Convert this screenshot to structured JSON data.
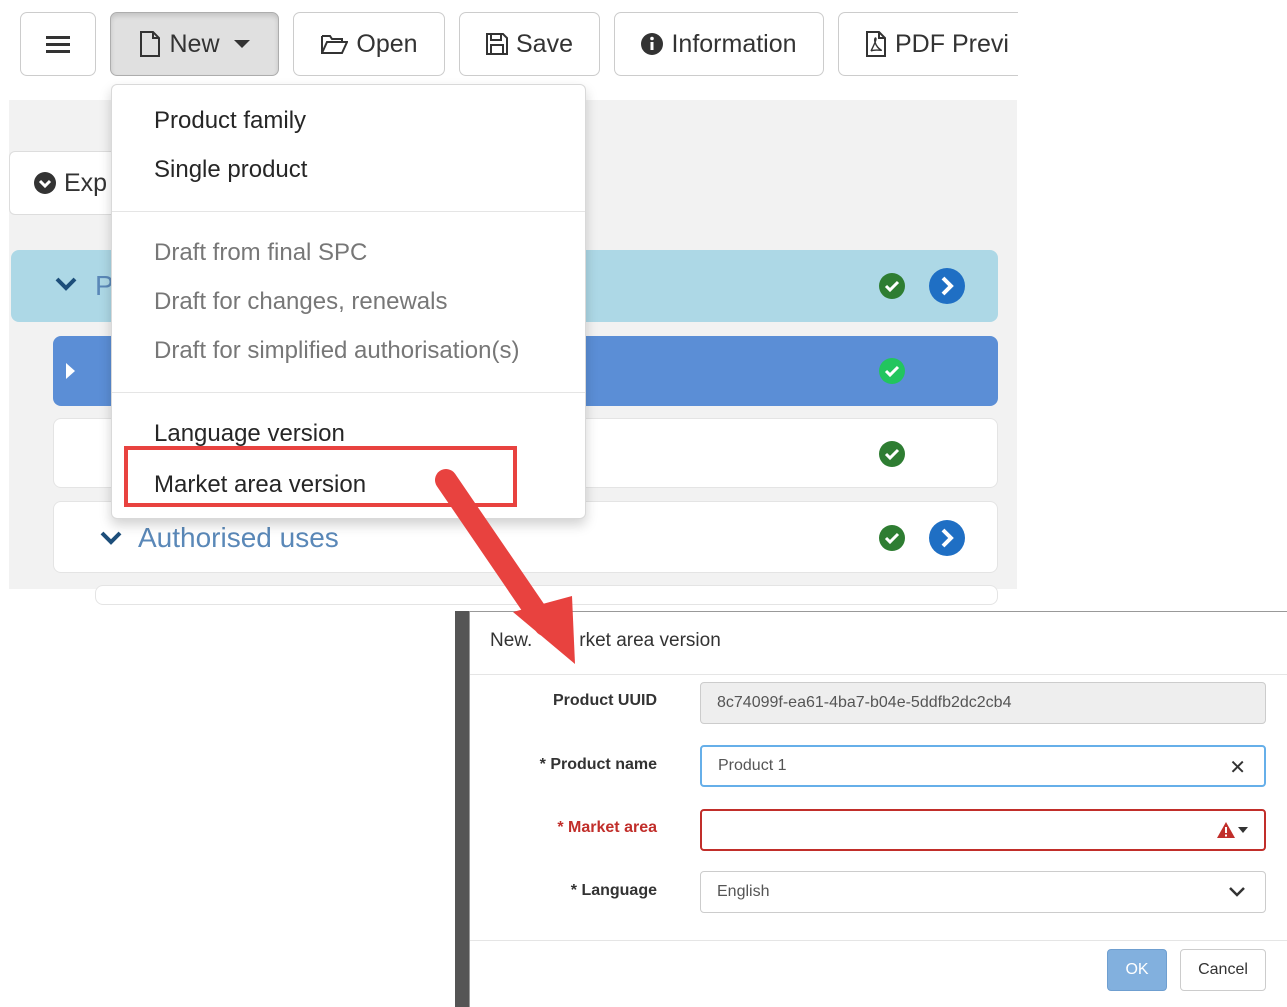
{
  "toolbar": {
    "menu_label": "",
    "new_label": "New",
    "open_label": "Open",
    "save_label": "Save",
    "info_label": "Information",
    "pdf_label": "PDF Previ"
  },
  "page": {
    "expand_label": "Exp",
    "row1_letter": "P",
    "authorised_uses_label": "Authorised uses"
  },
  "new_menu": {
    "items": [
      {
        "label": "Product family",
        "enabled": true
      },
      {
        "label": "Single product",
        "enabled": true
      },
      {
        "label": "Draft from final SPC",
        "enabled": false
      },
      {
        "label": "Draft for changes, renewals",
        "enabled": false
      },
      {
        "label": "Draft for simplified authorisation(s)",
        "enabled": false
      },
      {
        "label": "Language version",
        "enabled": true
      },
      {
        "label": "Market area version",
        "enabled": true
      }
    ]
  },
  "modal": {
    "title": "New Market area version",
    "title_visible_start": "New.",
    "title_visible_end": "rket area version",
    "fields": {
      "uuid_label": "Product UUID",
      "uuid_value": "8c74099f-ea61-4ba7-b04e-5ddfb2dc2cb4",
      "name_label": "* Product name",
      "name_value": "Product 1",
      "market_label": "* Market area",
      "market_value": "",
      "language_label": "* Language",
      "language_value": "English"
    },
    "ok_label": "OK",
    "cancel_label": "Cancel"
  },
  "colors": {
    "highlight_red": "#e8423f",
    "row_light_blue": "#add8e6",
    "row_selected_blue": "#5b8ed6",
    "status_green": "#2e7d32",
    "nav_blue": "#1f6fc4",
    "error_red": "#c12e2a"
  }
}
